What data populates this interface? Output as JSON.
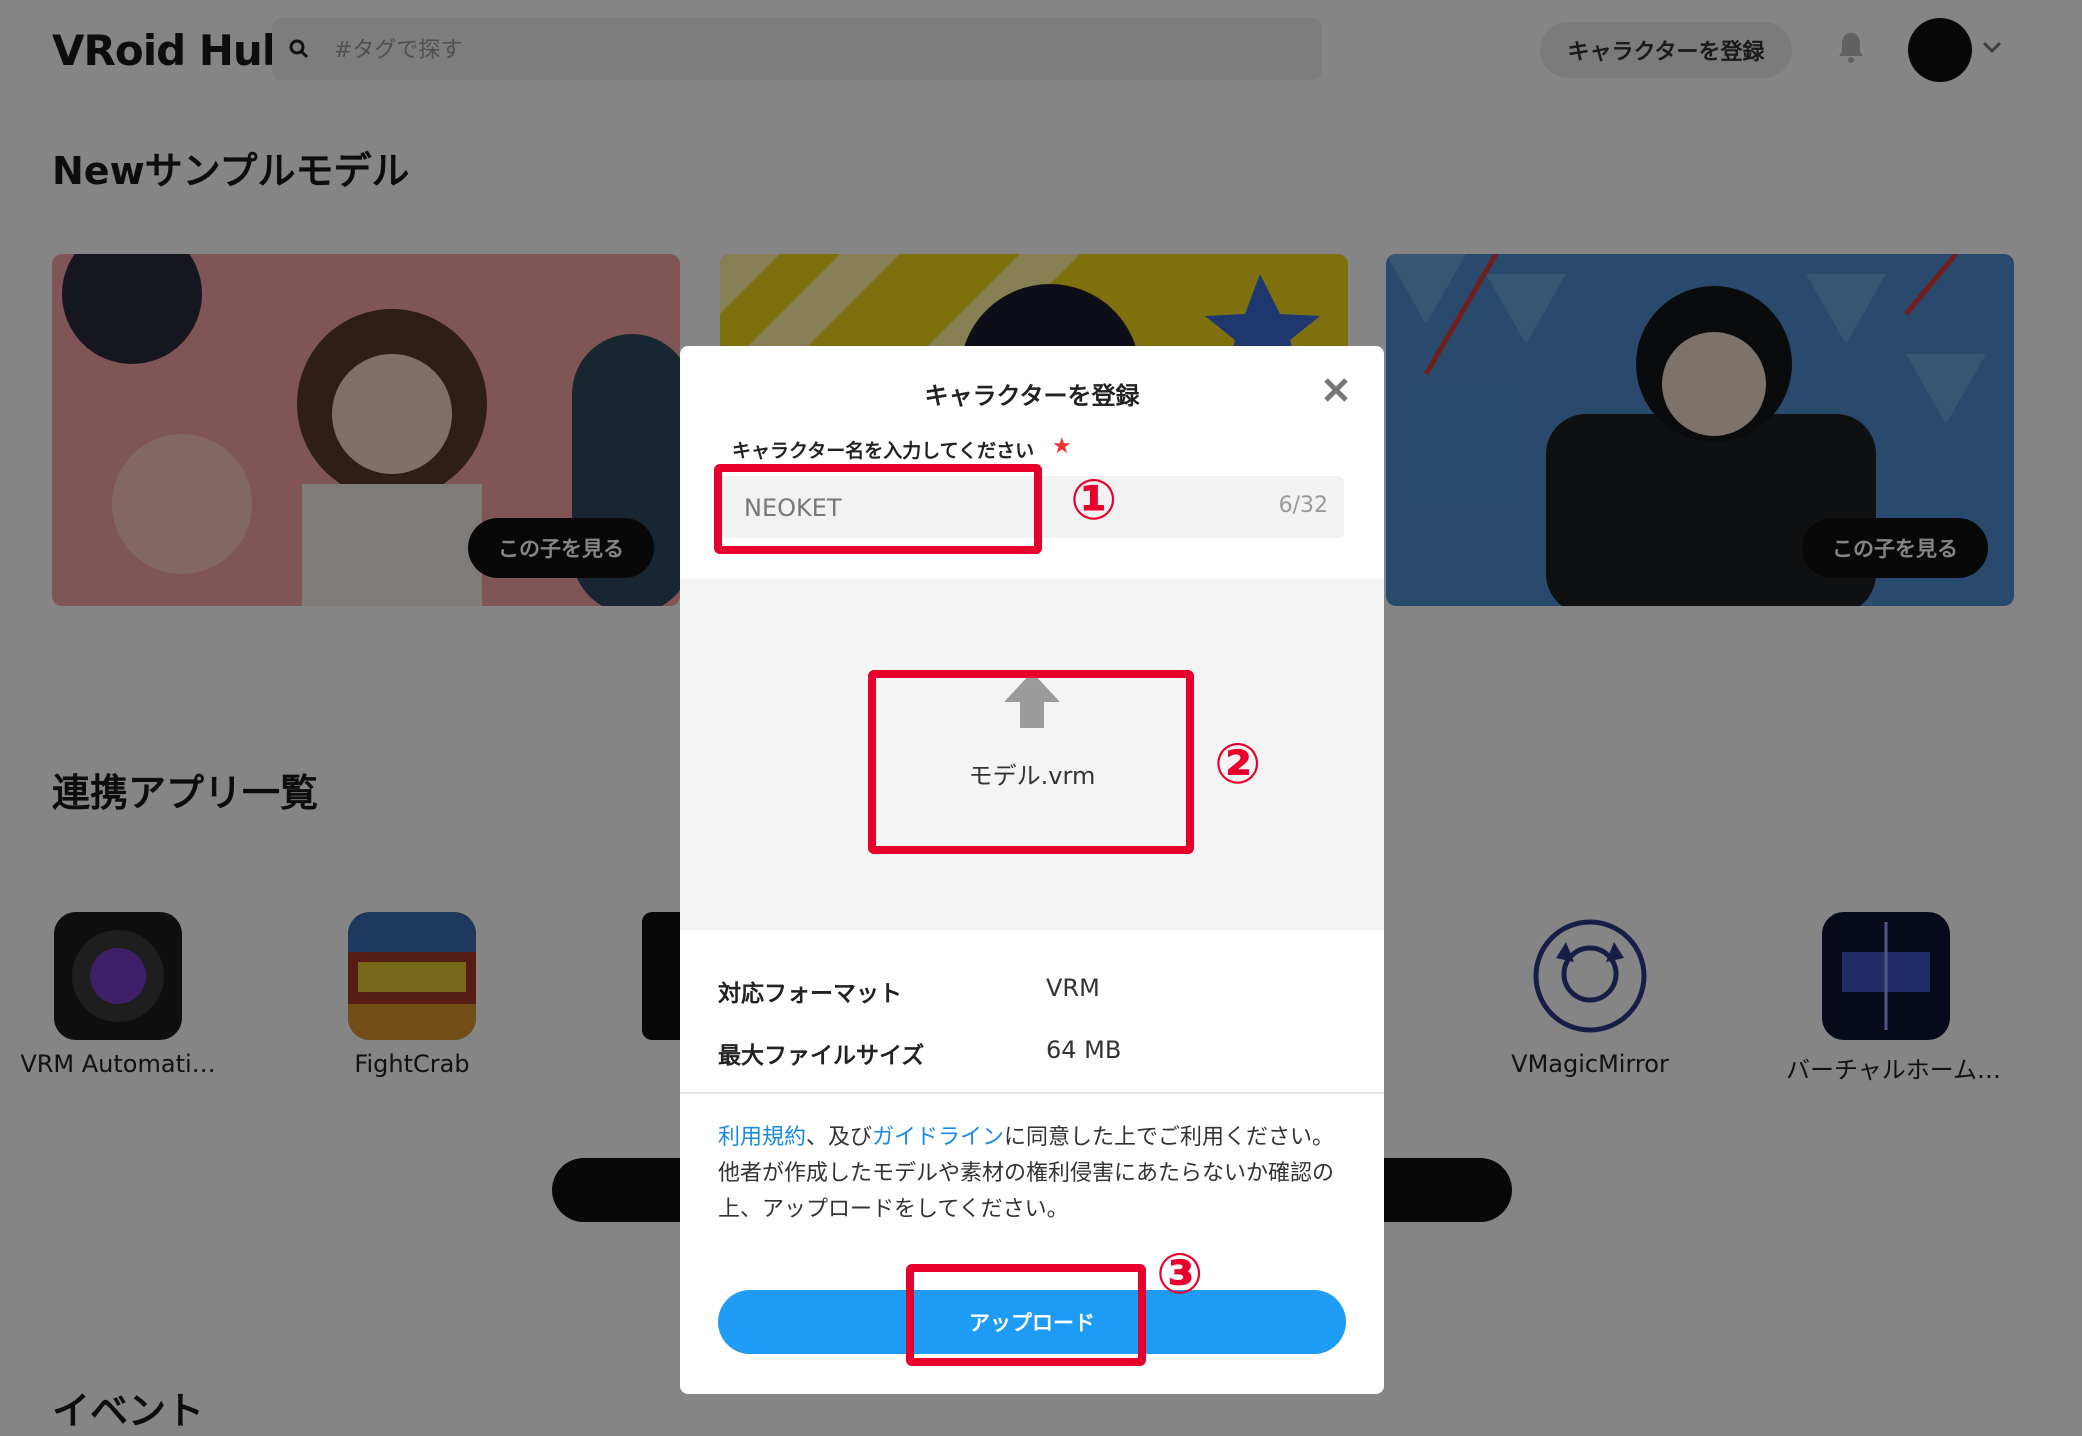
{
  "header": {
    "logo": "VRoid Hub",
    "search_placeholder": "#タグで探す",
    "register_label": "キャラクターを登録"
  },
  "sections": {
    "new_samples": "Newサンプルモデル",
    "apps": "連携アプリ一覧",
    "events": "イベント"
  },
  "cards": [
    {
      "button": "この子を見る"
    },
    {
      "button": ""
    },
    {
      "button": "この子を見る"
    }
  ],
  "apps": [
    {
      "label": "VRM Automati…"
    },
    {
      "label": "FightCrab"
    },
    {
      "label": "VMagicMirror"
    },
    {
      "label": "バーチャルホーム…"
    }
  ],
  "modal": {
    "title": "キャラクターを登録",
    "name_label": "キャラクター名を入力してください",
    "required_mark": "★",
    "name_value": "NEOKET",
    "counter": "6/32",
    "file_name": "モデル.vrm",
    "specs": [
      {
        "key": "対応フォーマット",
        "value": "VRM"
      },
      {
        "key": "最大ファイルサイズ",
        "value": "64 MB"
      }
    ],
    "terms_link": "利用規約",
    "terms_mid": "、及び",
    "guideline_link": "ガイドライン",
    "terms_rest": "に同意した上でご利用ください。",
    "notice": "他者が作成したモデルや素材の権利侵害にあたらないか確認の上、アップロードをしてください。",
    "upload_label": "アップロード"
  },
  "annotations": [
    "①",
    "②",
    "③"
  ],
  "colors": {
    "accent": "#1e9bf5",
    "annotation": "#e8002d",
    "link": "#1a8ae6"
  }
}
